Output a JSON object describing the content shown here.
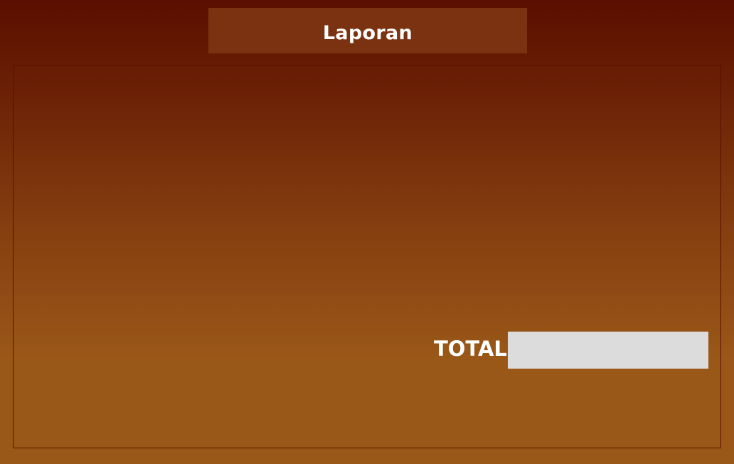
{
  "header": {
    "title": "Laporan"
  },
  "report": {
    "total_label": "TOTAL",
    "total_value": ""
  },
  "colors": {
    "title_bar_bg": "#7a3210",
    "bg_top": "#5a0f00",
    "bg_bottom": "#9a5818",
    "input_bg": "#dcdcdc"
  }
}
